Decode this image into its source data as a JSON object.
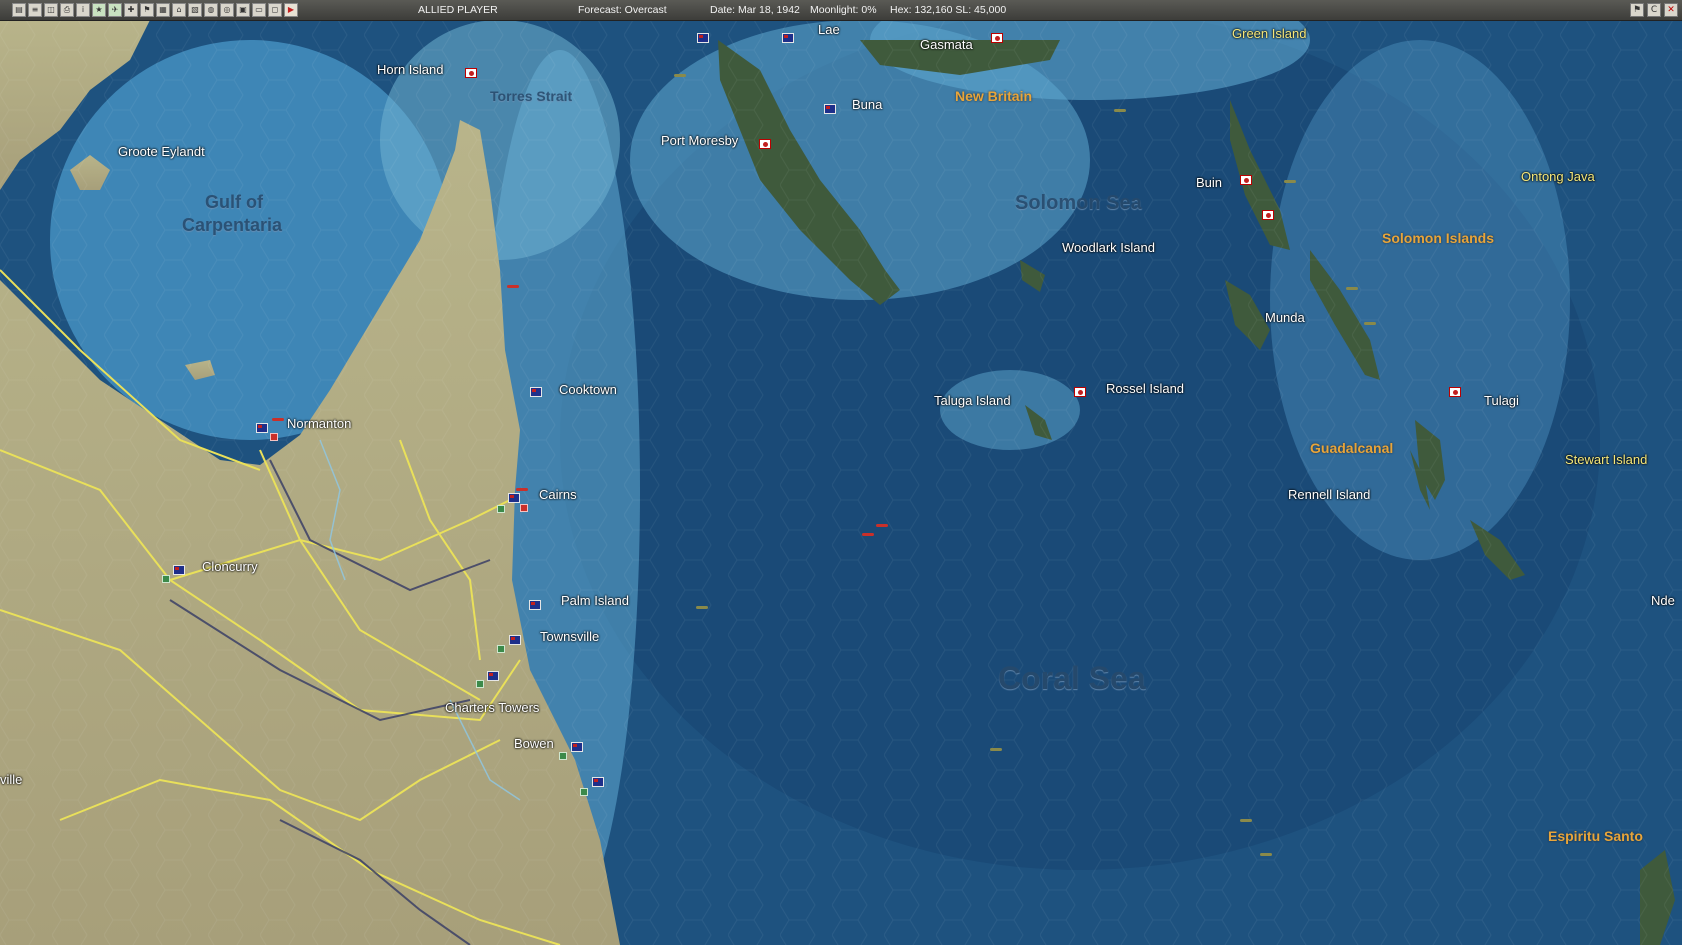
{
  "toolbar": {
    "buttons": [
      "report-icon",
      "list-icon",
      "intel-icon",
      "printer-icon",
      "info-icon",
      "star-icon",
      "air-icon",
      "plus-icon",
      "flag-icon",
      "chart-icon",
      "hq-icon",
      "map-icon",
      "globe-icon",
      "op-icon",
      "db-icon",
      "screen-icon",
      "window-icon"
    ],
    "play_symbol": "▶"
  },
  "status": {
    "player": "ALLIED PLAYER",
    "forecast": "Forecast: Overcast",
    "date": "Date: Mar 18, 1942",
    "moonlight": "Moonlight: 0%",
    "hex": "Hex: 132,160  SL: 45,000"
  },
  "window_controls": {
    "restore": "C",
    "close": "✕"
  },
  "map": {
    "sea_labels": {
      "coral_sea": "Coral Sea",
      "solomon_sea": "Solomon Sea",
      "gulf_line1": "Gulf of",
      "gulf_line2": "Carpentaria",
      "torres_strait": "Torres Strait"
    },
    "regions": {
      "new_britain": "New Britain",
      "solomon_islands": "Solomon Islands",
      "guadalcanal": "Guadalcanal",
      "espiritu_santo": "Espiritu Santo"
    },
    "places": {
      "lae": "Lae",
      "gasmata": "Gasmata",
      "green_island": "Green Island",
      "horn_island": "Horn Island",
      "buna": "Buna",
      "port_moresby": "Port Moresby",
      "groote_eylandt": "Groote Eylandt",
      "buin": "Buin",
      "ontong_java": "Ontong Java",
      "woodlark_island": "Woodlark Island",
      "munda": "Munda",
      "cooktown": "Cooktown",
      "taluga_island": "Taluga Island",
      "rossel_island": "Rossel Island",
      "tulagi": "Tulagi",
      "normanton": "Normanton",
      "stewart_island": "Stewart Island",
      "cairns": "Cairns",
      "rennell_island": "Rennell Island",
      "cloncurry": "Cloncurry",
      "palm_island": "Palm Island",
      "noumea_partial": "Nde",
      "townsville": "Townsville",
      "charters_towers": "Charters Towers",
      "bowen": "Bowen",
      "ville_partial": "ville"
    }
  }
}
